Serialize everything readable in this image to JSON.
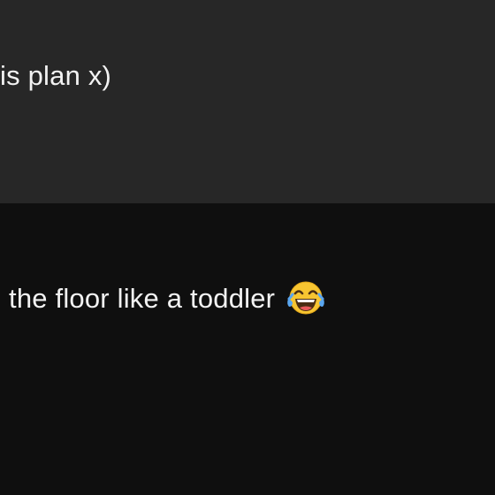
{
  "messages": [
    {
      "text": "is plan x)"
    },
    {
      "text": "the floor like a toddler",
      "emoji": "face-with-tears-of-joy-icon"
    }
  ],
  "colors": {
    "top_row_bg": "#272727",
    "bottom_row_bg": "#0f0f0f",
    "text": "#f2f2f2"
  }
}
